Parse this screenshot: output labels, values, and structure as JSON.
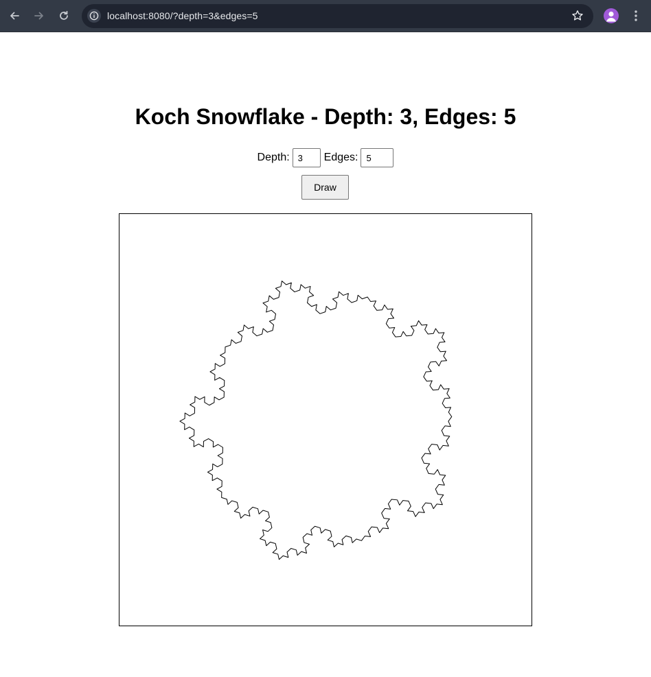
{
  "browser": {
    "url": "localhost:8080/?depth=3&edges=5",
    "nav_icons": [
      "back-arrow-icon",
      "forward-arrow-icon",
      "reload-icon"
    ],
    "colors": {
      "toolbar": "#333a46",
      "omnibox": "#1f2430",
      "url_text": "#e8eaed",
      "avatar": "#a05ad8"
    }
  },
  "page": {
    "title": "Koch Snowflake - Depth: 3, Edges: 5",
    "depth_label": "Depth:",
    "depth_value": "3",
    "edges_label": "Edges:",
    "edges_value": "5",
    "draw_label": "Draw"
  },
  "snowflake": {
    "depth": 3,
    "edges": 5,
    "stroke_color": "#000000"
  }
}
